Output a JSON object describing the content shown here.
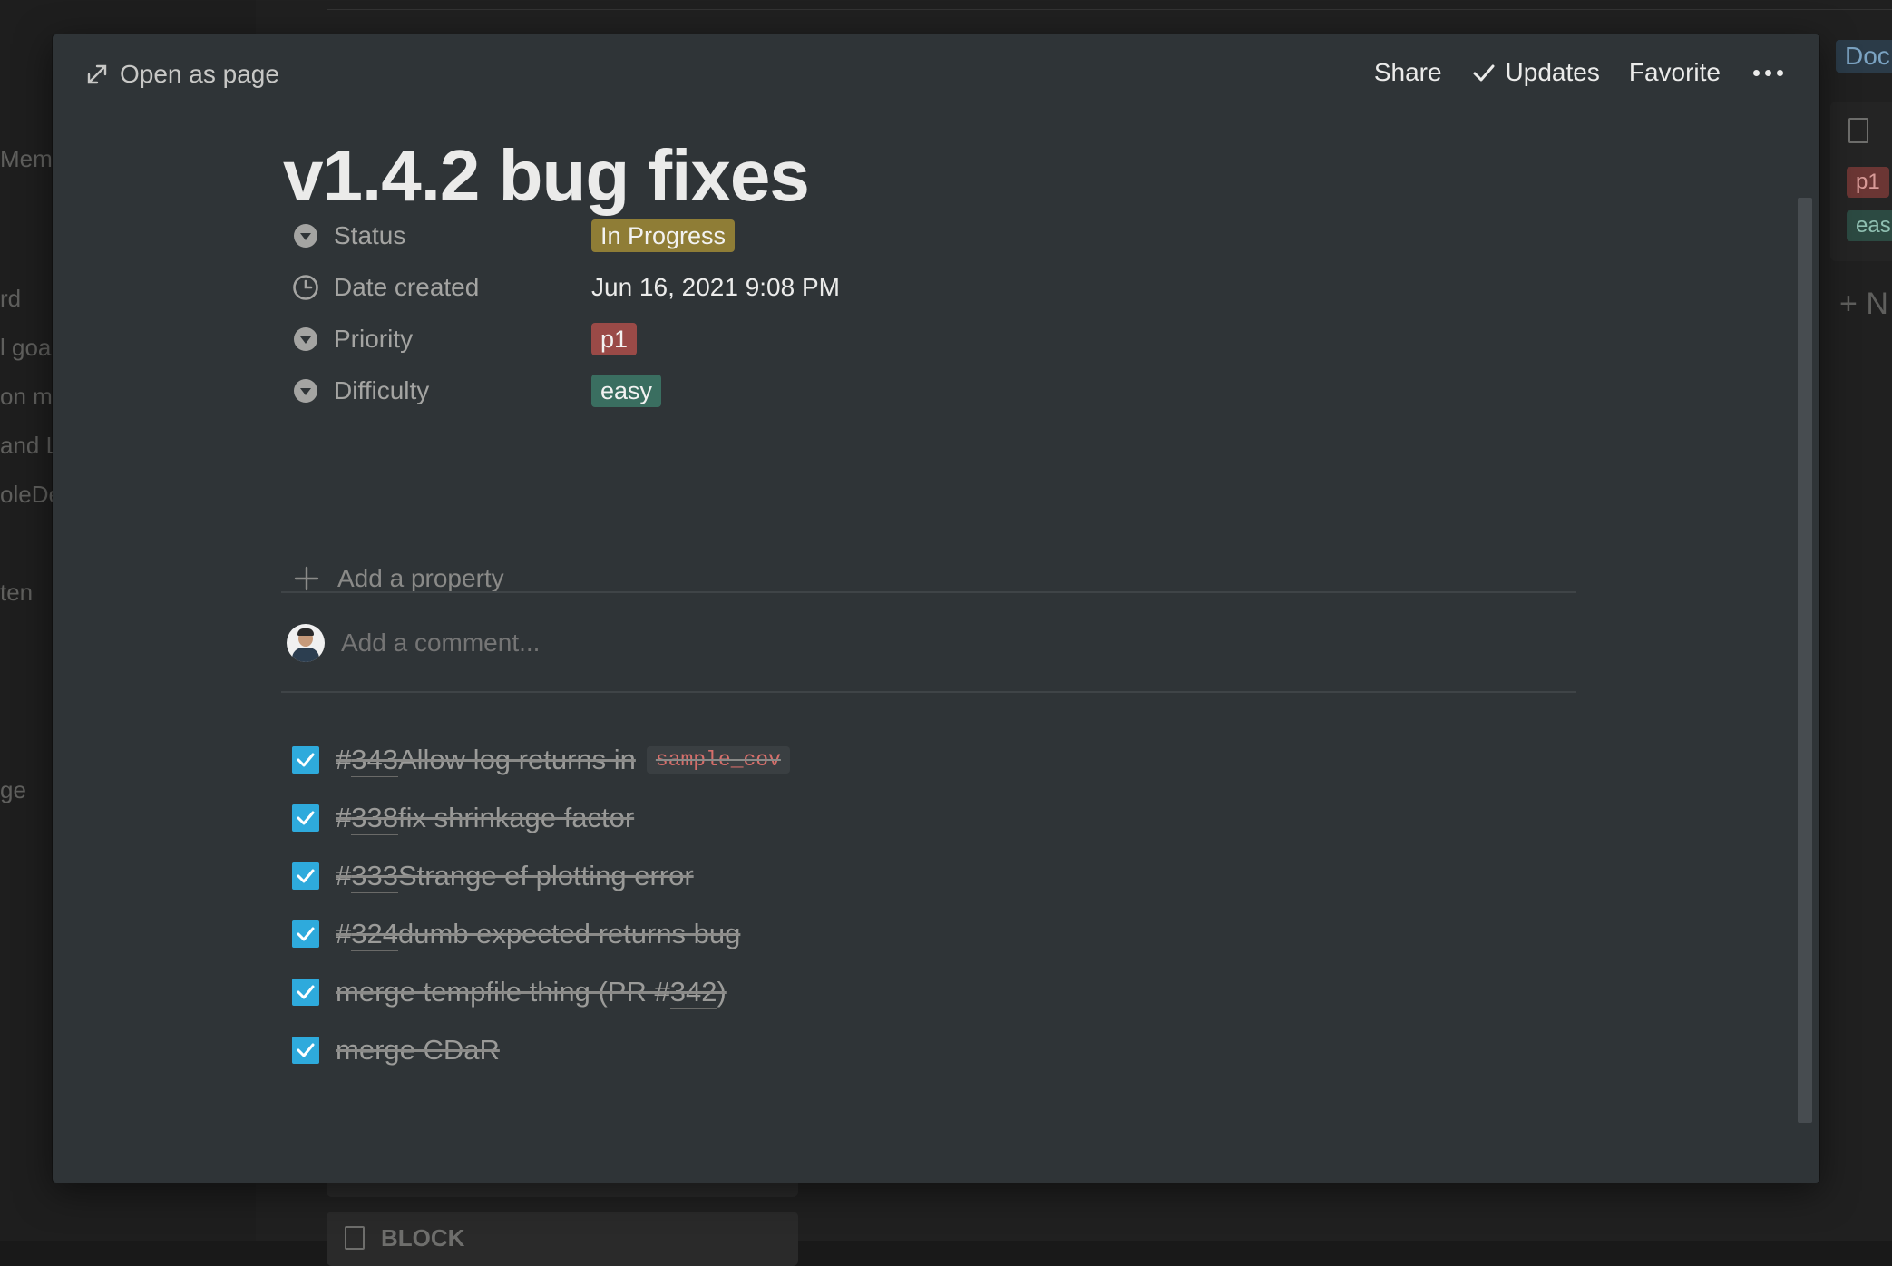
{
  "background": {
    "sidebar_fragments": [
      "Memb",
      "rd",
      "l goa",
      "on m",
      "and L",
      "oleDe",
      "ten",
      "ge"
    ],
    "card_label": "BLOCK",
    "right_tab": "Doc",
    "right_tags": [
      "p1",
      "eas"
    ],
    "right_new": "N"
  },
  "topbar": {
    "open_as_page": "Open as page",
    "share": "Share",
    "updates": "Updates",
    "favorite": "Favorite"
  },
  "page": {
    "title": "v1.4.2 bug fixes"
  },
  "properties": [
    {
      "icon": "select-icon",
      "label": "Status",
      "value": "In Progress",
      "color": "#8f7d36"
    },
    {
      "icon": "clock-icon",
      "label": "Date created",
      "value": "Jun 16, 2021 9:08 PM"
    },
    {
      "icon": "select-icon",
      "label": "Priority",
      "value": "p1",
      "color": "#9a4a47"
    },
    {
      "icon": "select-icon",
      "label": "Difficulty",
      "value": "easy",
      "color": "#3a6e60"
    }
  ],
  "add_property": "Add a property",
  "comment": {
    "placeholder": "Add a comment..."
  },
  "todos": [
    {
      "prefix": "#",
      "ref": "343",
      "text": " Allow log returns in",
      "code": "sample_cov",
      "checked": true
    },
    {
      "prefix": "#",
      "ref": "338",
      "text": " fix shrinkage factor",
      "checked": true
    },
    {
      "prefix": "#",
      "ref": "333",
      "text": " Strange ef plotting error",
      "checked": true
    },
    {
      "prefix": "#",
      "ref": "324",
      "text": " dumb expected returns bug",
      "checked": true
    },
    {
      "prefix": "merge tempfile thing (PR #",
      "ref": "342",
      "suffix": ")",
      "checked": true
    },
    {
      "prefix": "merge CDaR",
      "checked": true
    }
  ],
  "colors": {
    "modal_bg": "#2f3437",
    "checkbox": "#2eaadc",
    "code_text": "#d76e6a"
  }
}
